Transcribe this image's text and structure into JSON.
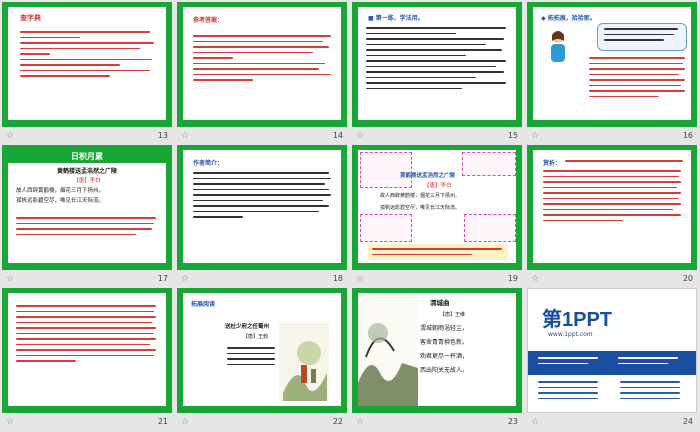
{
  "slides": [
    {
      "number": "13",
      "title": "查字典"
    },
    {
      "number": "14",
      "title": "参考答案："
    },
    {
      "number": "15",
      "title": "■ 第一练、学法用。"
    },
    {
      "number": "16",
      "title": "◆ 拓拓展，拾拾家。"
    },
    {
      "number": "17",
      "title": "日积月累",
      "poem_title": "黄鹤楼送孟浩然之广陵",
      "author": "【唐】李白",
      "lines": [
        "故人西辞黄鹤楼，烟花三月下扬州。",
        "孤帆远影碧空尽，唯见长江天际流。"
      ]
    },
    {
      "number": "18",
      "title": "作者简介："
    },
    {
      "number": "19",
      "title": "黄鹤楼送孟浩然之广陵",
      "author": "【唐】李白",
      "lines": [
        "故人西辞黄鹤楼，烟花三月下扬州。",
        "孤帆远影碧空尽，唯见长江天际流。"
      ]
    },
    {
      "number": "20",
      "title": "赏析："
    },
    {
      "number": "21",
      "title": ""
    },
    {
      "number": "22",
      "title": "拓展阅读",
      "poem_title": "送杜少府之任蜀州",
      "author": "【唐】王勃"
    },
    {
      "number": "23",
      "title": "渭城曲",
      "author": "【唐】王维",
      "lines": [
        "渭城朝雨浥轻尘，",
        "客舍青青柳色新。",
        "劝君更尽一杯酒，",
        "西出阳关无故人。"
      ]
    },
    {
      "number": "24",
      "title": "第1PPT",
      "url": "www.1ppt.com"
    }
  ]
}
